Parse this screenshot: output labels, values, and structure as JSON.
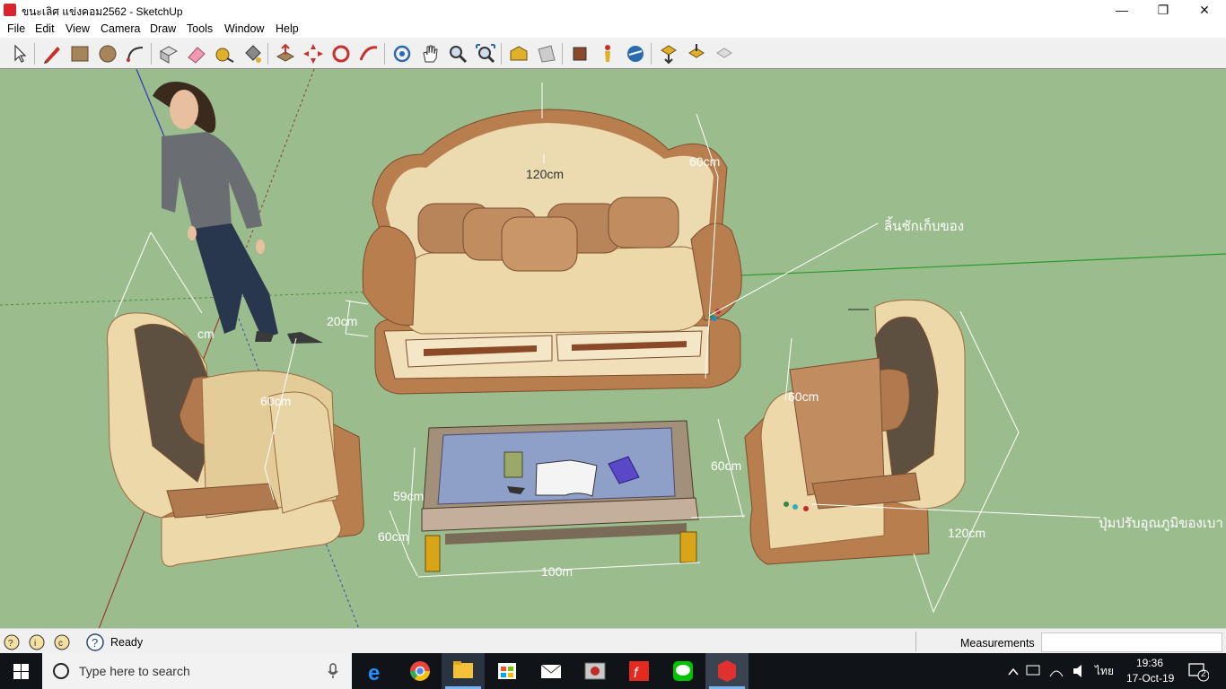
{
  "window": {
    "title": "ขนะเลิศ แข่งคอม2562 - SketchUp",
    "minimize": "—",
    "maximize": "❐",
    "close": "✕"
  },
  "menu": [
    "File",
    "Edit",
    "View",
    "Camera",
    "Draw",
    "Tools",
    "Window",
    "Help"
  ],
  "toolbar": {
    "tools": [
      "select-tool",
      "pencil-tool",
      "rectangle-tool",
      "circle-tool",
      "arc-tool",
      "eraser-group",
      "paint-bucket",
      "tape-measure",
      "paint-tool",
      "push-pull-tool",
      "move-tool",
      "rotate-tool",
      "follow-me-tool",
      "orbit-tool",
      "pan-tool",
      "zoom-tool",
      "zoom-extents-tool",
      "import-tool",
      "share-tool",
      "3d-warehouse-tool",
      "extension-tool",
      "geo-tool",
      "send-tool",
      "get-models-tool",
      "export-tool"
    ]
  },
  "model": {
    "labels": {
      "top_height": "120cm",
      "back_height": "60cm",
      "storage": "ลิ้นชักเก็บของ",
      "base_height": "20cm",
      "left_chair_width": "60cm",
      "left_partial": "cm",
      "right_chair_width": "60cm",
      "table_depth": "60cm",
      "table_height_upper": "59cm",
      "table_height_lower": "60cm",
      "table_length": "100m",
      "temp_button": "ปุ่มปรับอุณภูมิของเบา",
      "right_chair_height": "120cm"
    }
  },
  "status": {
    "text": "Ready",
    "measurements_label": "Measurements",
    "measurements_value": ""
  },
  "taskbar": {
    "search_placeholder": "Type here to search",
    "language": "ไทย",
    "time": "19:36",
    "date": "17-Oct-19",
    "notifications": "2"
  }
}
